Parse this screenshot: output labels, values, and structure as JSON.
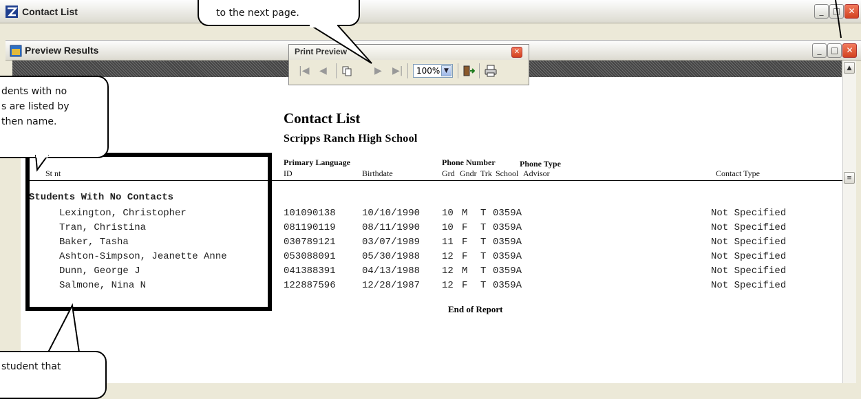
{
  "window": {
    "title": "Contact List"
  },
  "preview_window": {
    "title": "Preview Results"
  },
  "print_preview_toolbar": {
    "title": "Print Preview",
    "zoom_value": "100%",
    "zoom_options": [
      "100%"
    ],
    "icons": [
      "first-page-icon",
      "previous-page-icon",
      "multi-page-icon",
      "next-page-icon",
      "last-page-icon",
      "exit-icon",
      "printer-icon"
    ]
  },
  "callouts": {
    "top": "to the next page.",
    "left": "dents with no\ns are listed by\nthen name.",
    "bottom": "student that"
  },
  "report": {
    "title": "Contact List",
    "school": "Scripps Ranch High School",
    "headers": {
      "primary_language": "Primary Language",
      "phone_number": "Phone Number",
      "phone_type": "Phone Type",
      "student": "St   nt",
      "id": "ID",
      "birthdate": "Birthdate",
      "grd": "Grd",
      "gndr": "Gndr",
      "trk": "Trk",
      "school": "School",
      "advisor": "Advisor",
      "contact_type": "Contact Type"
    },
    "section_title": "Students With No Contacts",
    "rows": [
      {
        "name": "Lexington, Christopher",
        "id": "101090138",
        "birthdate": "10/10/1990",
        "grd": "10",
        "gndr": "M",
        "trk": "T",
        "school": "0359A",
        "contact_type": "Not Specified"
      },
      {
        "name": "Tran, Christina",
        "id": "081190119",
        "birthdate": "08/11/1990",
        "grd": "10",
        "gndr": "F",
        "trk": "T",
        "school": "0359A",
        "contact_type": "Not Specified"
      },
      {
        "name": "Baker, Tasha",
        "id": "030789121",
        "birthdate": "03/07/1989",
        "grd": "11",
        "gndr": "F",
        "trk": "T",
        "school": "0359A",
        "contact_type": "Not Specified"
      },
      {
        "name": "Ashton-Simpson, Jeanette Anne",
        "id": "053088091",
        "birthdate": "05/30/1988",
        "grd": "12",
        "gndr": "F",
        "trk": "T",
        "school": "0359A",
        "contact_type": "Not Specified"
      },
      {
        "name": "Dunn, George J",
        "id": "041388391",
        "birthdate": "04/13/1988",
        "grd": "12",
        "gndr": "M",
        "trk": "T",
        "school": "0359A",
        "contact_type": "Not Specified"
      },
      {
        "name": "Salmone, Nina N",
        "id": "122887596",
        "birthdate": "12/28/1987",
        "grd": "12",
        "gndr": "F",
        "trk": "T",
        "school": "0359A",
        "contact_type": "Not Specified"
      }
    ],
    "footer": "End of Report"
  },
  "colors": {
    "highlight_box": "#000000",
    "close_button": "#d24120",
    "window_bg": "#ece9d8"
  }
}
